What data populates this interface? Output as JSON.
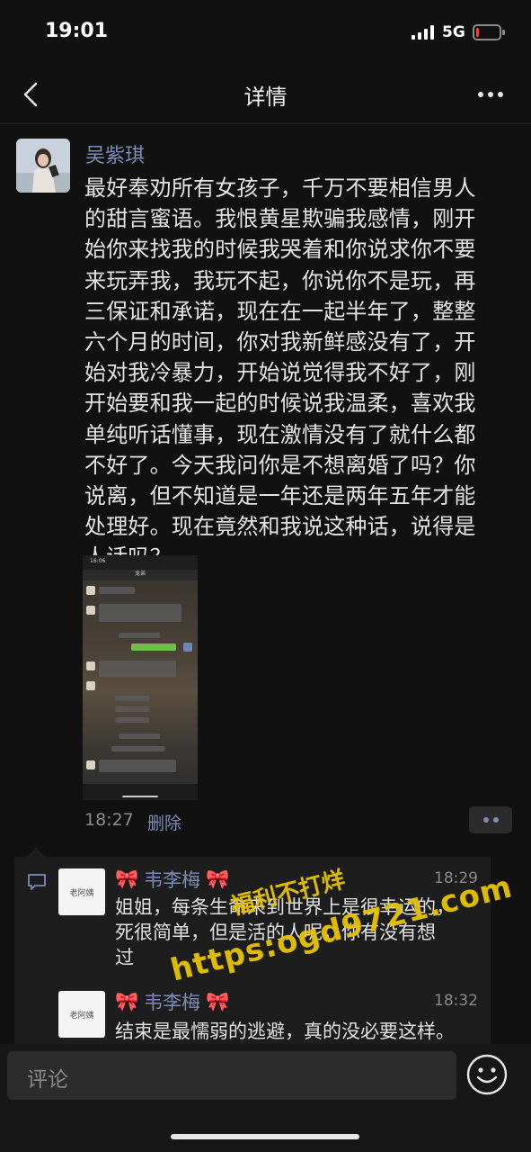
{
  "status_bar": {
    "time": "19:01",
    "network": "5G",
    "battery_level": 0.12
  },
  "nav": {
    "title": "详情"
  },
  "post": {
    "author": "吴紫琪",
    "text": "最好奉劝所有女孩子，千万不要相信男人\n的甜言蜜语。我恨黄星欺骗我感情，刚开\n始你来找我的时候我哭着和你说求你不要\n来玩弄我，我玩不起，你说你不是玩，再\n三保证和承诺，现在在一起半年了，整整\n六个月的时间，你对我新鲜感没有了，开\n始对我冷暴力，开始说觉得我不好了，刚\n开始要和我一起的时候说我温柔，喜欢我\n单纯听话懂事，现在激情没有了就什么都\n不好了。今天我问你是不想离婚了吗？你\n说离，但不知道是一年还是两年五年才能\n处理好。现在竟然和我说这种话，说得是\n人话吗？",
    "image": {
      "status_time": "16:06",
      "title": "龙弟"
    },
    "time": "18:27",
    "delete_label": "删除"
  },
  "comments": [
    {
      "name": "韦李梅",
      "avatar_text": "老阿姨",
      "time": "18:29",
      "text": "姐姐，每条生命来到世界上是很幸运的，\n死很简单，但是活的人呢，你有没有想\n过"
    },
    {
      "name": "韦李梅",
      "avatar_text": "老阿姨",
      "time": "18:32",
      "text": "结束是最懦弱的逃避，真的没必要这样。"
    }
  ],
  "watermark": {
    "line1": "福利不打烊",
    "line2": "https:ogd9721.com"
  },
  "comment_bar": {
    "placeholder": "评论"
  }
}
